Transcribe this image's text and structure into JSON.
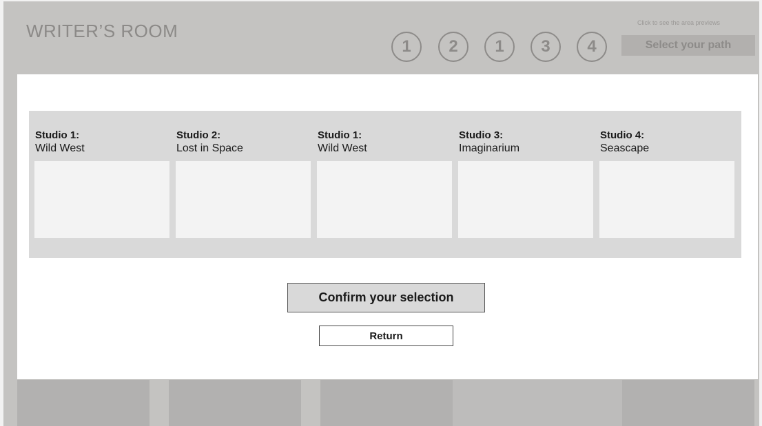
{
  "app": {
    "title": "WRITER’S ROOM"
  },
  "area_nav": {
    "buttons": [
      "1",
      "2",
      "1",
      "3",
      "4"
    ],
    "hint": "Click to see the area previews",
    "select_path_label": "Select your path"
  },
  "studios": [
    {
      "name": "Studio 1:",
      "theme": "Wild West"
    },
    {
      "name": "Studio 2:",
      "theme": "Lost in Space"
    },
    {
      "name": "Studio 1:",
      "theme": "Wild West"
    },
    {
      "name": "Studio 3:",
      "theme": "Imaginarium"
    },
    {
      "name": "Studio 4:",
      "theme": "Seascape"
    }
  ],
  "actions": {
    "confirm_label": "Confirm your selection",
    "return_label": "Return"
  },
  "colors": {
    "background": "#c4c3c1",
    "modal": "#ffffff",
    "panel": "#d9d9d9",
    "card": "#f3f3f3"
  }
}
